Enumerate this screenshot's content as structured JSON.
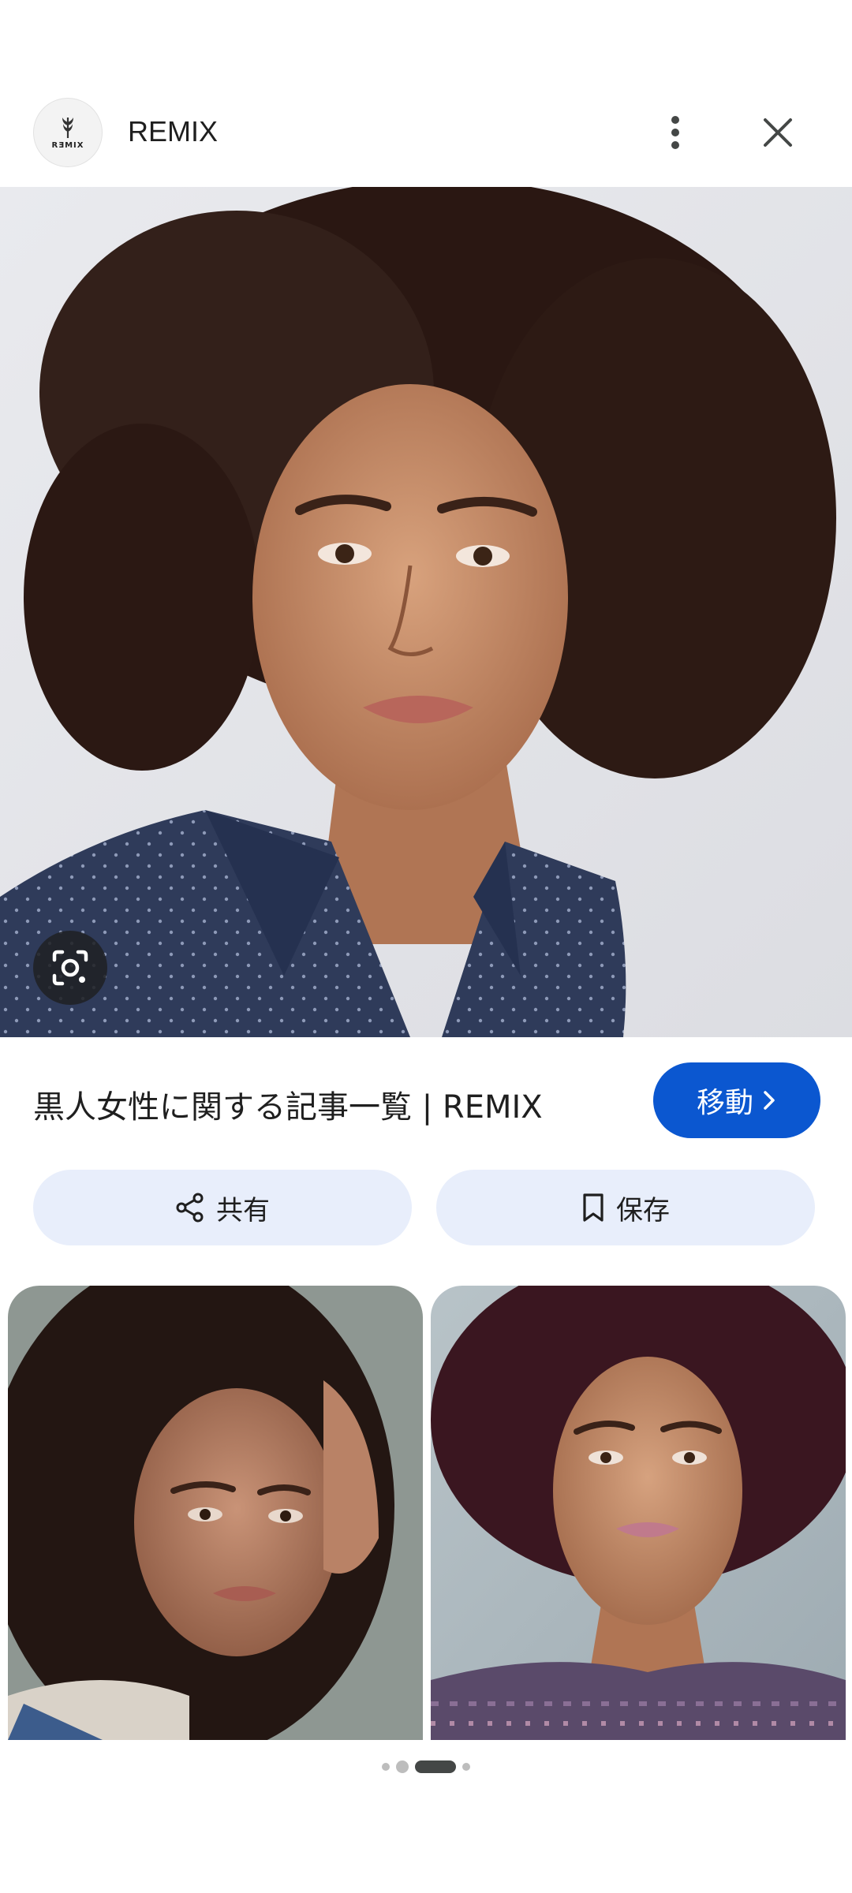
{
  "header": {
    "site_name": "REMIX",
    "logo_text": "RƎMIX",
    "logo_icon": "remix-logo-icon",
    "more_icon": "more-vert-icon",
    "close_icon": "close-icon"
  },
  "main_image": {
    "lens_icon": "lens-icon"
  },
  "result": {
    "title": "黒人女性に関する記事一覧 | REMIX",
    "visit_label": "移動"
  },
  "actions": {
    "share_label": "共有",
    "save_label": "保存"
  },
  "pager": {
    "active_index": 2,
    "dot_count": 4
  },
  "colors": {
    "primary": "#0b57d0",
    "chip_bg": "#e8eefb",
    "text": "#1f1f1f"
  }
}
